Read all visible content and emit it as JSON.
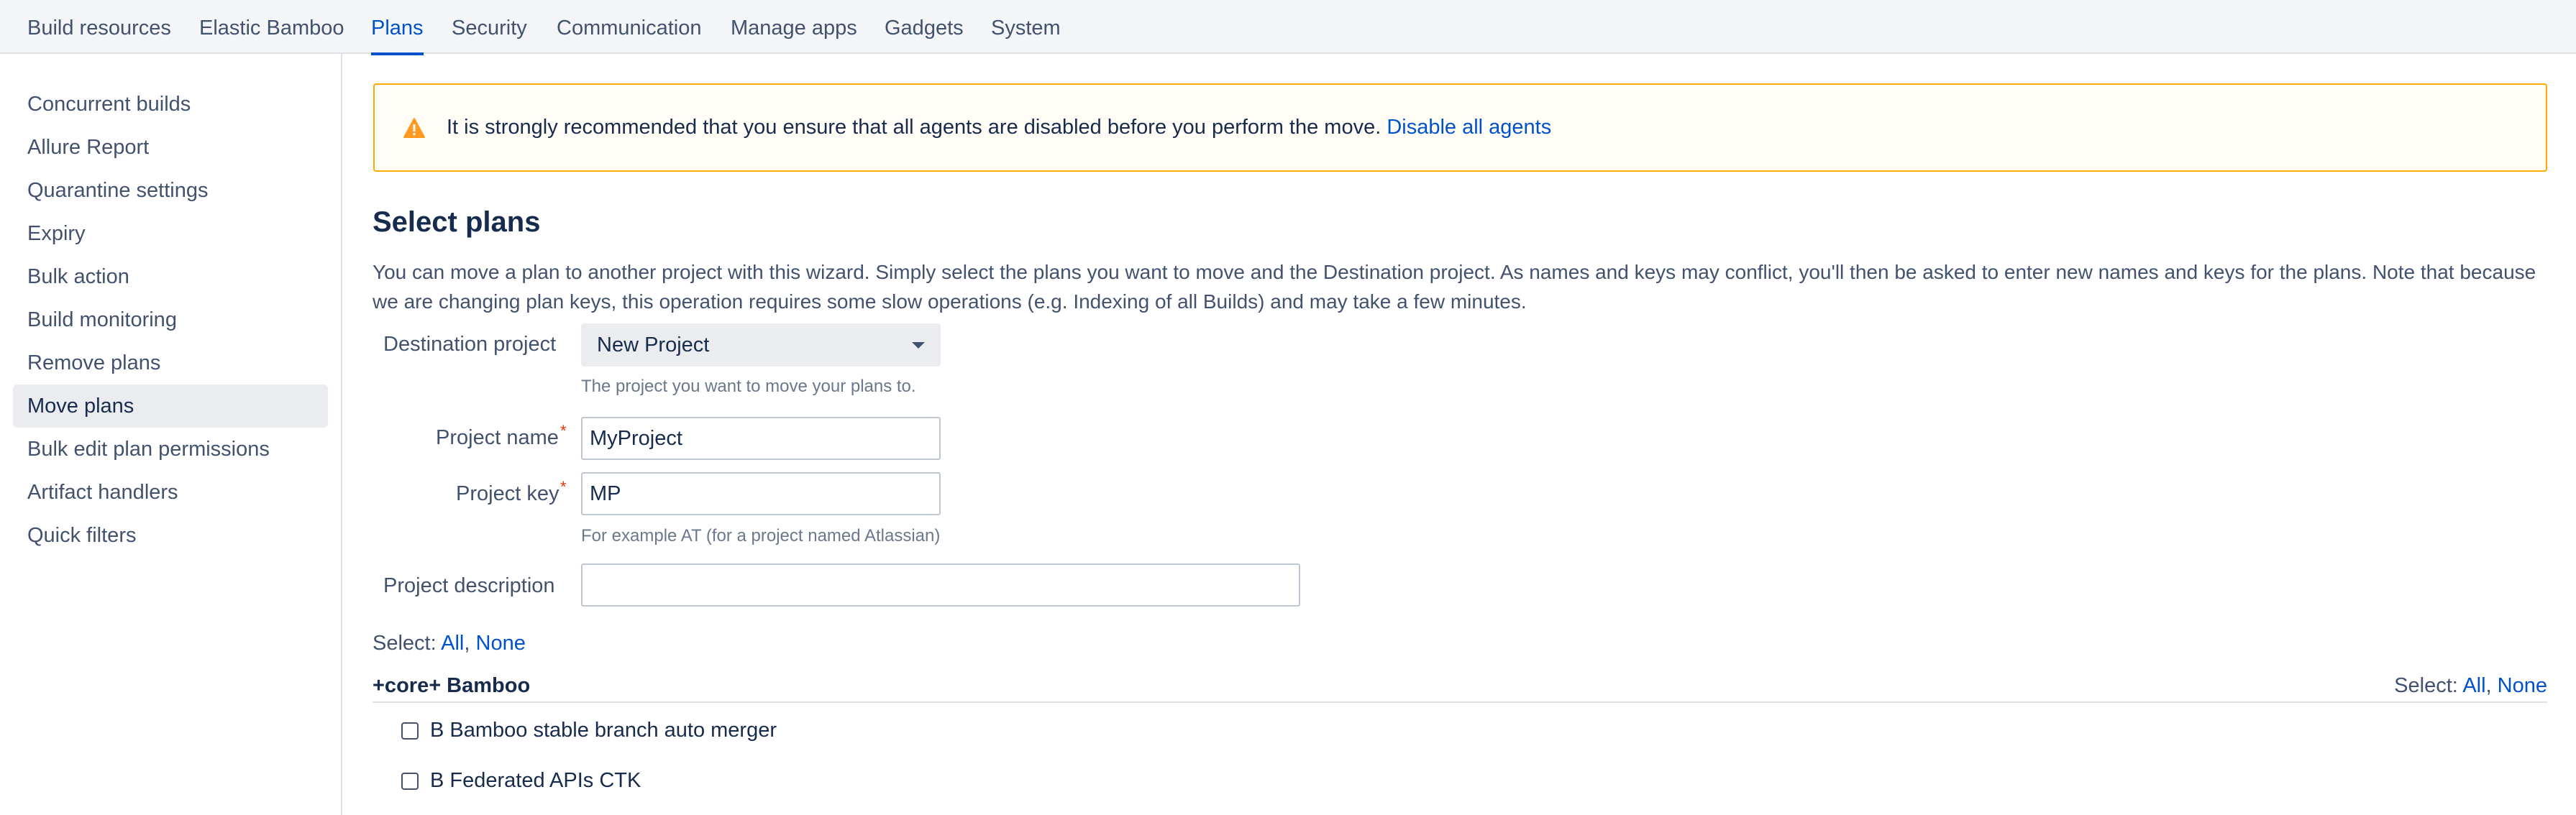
{
  "topnav": {
    "tabs": [
      {
        "label": "Build resources"
      },
      {
        "label": "Elastic Bamboo"
      },
      {
        "label": "Plans"
      },
      {
        "label": "Security"
      },
      {
        "label": "Communication"
      },
      {
        "label": "Manage apps"
      },
      {
        "label": "Gadgets"
      },
      {
        "label": "System"
      }
    ],
    "active": "Plans"
  },
  "sidebar": {
    "items": [
      {
        "label": "Concurrent builds"
      },
      {
        "label": "Allure Report"
      },
      {
        "label": "Quarantine settings"
      },
      {
        "label": "Expiry"
      },
      {
        "label": "Bulk action"
      },
      {
        "label": "Build monitoring"
      },
      {
        "label": "Remove plans"
      },
      {
        "label": "Move plans"
      },
      {
        "label": "Bulk edit plan permissions"
      },
      {
        "label": "Artifact handlers"
      },
      {
        "label": "Quick filters"
      }
    ],
    "active": "Move plans"
  },
  "warning": {
    "icon": "warning-triangle-icon",
    "message": "It is strongly recommended that you ensure that all agents are disabled before you perform the move.",
    "link": "Disable all agents"
  },
  "main": {
    "title": "Select plans",
    "description": "You can move a plan to another project with this wizard. Simply select the plans you want to move and the Destination project. As names and keys may conflict, you'll then be asked to enter new names and keys for the plans. Note that because we are changing plan keys, this operation requires some slow operations (e.g. Indexing of all Builds) and may take a few minutes."
  },
  "form": {
    "destination": {
      "label": "Destination project",
      "value": "New Project",
      "help": "The project you want to move your plans to."
    },
    "project_name": {
      "label": "Project name",
      "value": "MyProject"
    },
    "project_key": {
      "label": "Project key",
      "value": "MP",
      "help": "For example AT (for a project named Atlassian)"
    },
    "project_description": {
      "label": "Project description",
      "value": ""
    }
  },
  "selection": {
    "prefix": "Select:",
    "all": "All",
    "sep": ",",
    "none": "None"
  },
  "group": {
    "name": "+core+ Bamboo",
    "plans": [
      {
        "label": "B Bamboo stable branch auto merger",
        "checked": false
      },
      {
        "label": "B Federated APIs CTK",
        "checked": false
      }
    ]
  },
  "colors": {
    "accent": "#0052cc",
    "warning_border": "#ffab00",
    "required": "#de350b"
  }
}
